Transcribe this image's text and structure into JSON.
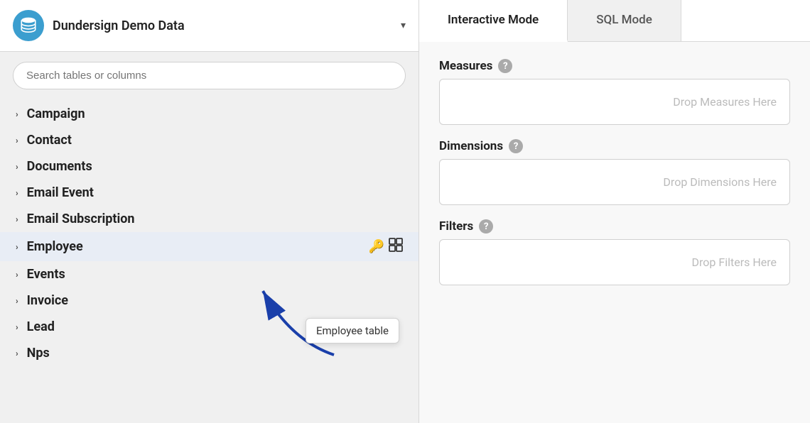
{
  "sidebar": {
    "db_icon_alt": "database-icon",
    "db_title": "Dundersign Demo Data",
    "dropdown_label": "▾",
    "search_placeholder": "Search tables or columns",
    "tables": [
      {
        "id": "campaign",
        "name": "Campaign"
      },
      {
        "id": "contact",
        "name": "Contact"
      },
      {
        "id": "documents",
        "name": "Documents"
      },
      {
        "id": "email-event",
        "name": "Email Event"
      },
      {
        "id": "email-subscription",
        "name": "Email Subscription"
      },
      {
        "id": "employee",
        "name": "Employee",
        "active": true,
        "show_icons": true
      },
      {
        "id": "events",
        "name": "Events"
      },
      {
        "id": "invoice",
        "name": "Invoice"
      },
      {
        "id": "lead",
        "name": "Lead"
      },
      {
        "id": "nps",
        "name": "Nps"
      }
    ]
  },
  "tooltip": {
    "text": "Employee table"
  },
  "main": {
    "tabs": [
      {
        "id": "interactive",
        "label": "Interactive Mode",
        "active": true
      },
      {
        "id": "sql",
        "label": "SQL Mode",
        "active": false
      }
    ],
    "sections": [
      {
        "id": "measures",
        "label": "Measures",
        "drop_placeholder": "Drop Measures Here"
      },
      {
        "id": "dimensions",
        "label": "Dimensions",
        "drop_placeholder": "Drop Dimensions Here"
      },
      {
        "id": "filters",
        "label": "Filters",
        "drop_placeholder": "Drop Filters Here"
      }
    ]
  }
}
